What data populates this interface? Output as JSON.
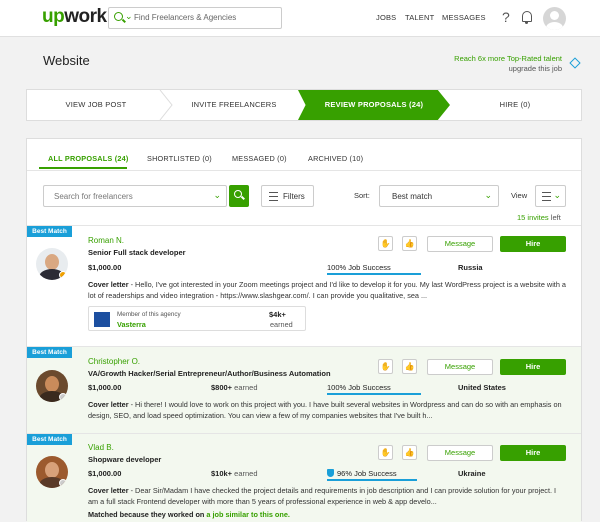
{
  "header": {
    "logo": "upwork",
    "search_placeholder": "Find Freelancers & Agencies",
    "nav": [
      "JOBS",
      "TALENT",
      "MESSAGES"
    ],
    "help": "?"
  },
  "page": {
    "title": "Website",
    "promo_line1": "Reach 6x more Top-Rated talent",
    "promo_line2": "upgrade this job"
  },
  "steps": [
    "VIEW JOB POST",
    "INVITE FREELANCERS",
    "REVIEW PROPOSALS (24)",
    "HIRE (0)"
  ],
  "tabs": [
    "ALL PROPOSALS (24)",
    "SHORTLISTED (0)",
    "MESSAGED (0)",
    "ARCHIVED (10)"
  ],
  "toolbar": {
    "search_placeholder": "Search for freelancers",
    "filters_label": "Filters",
    "sort_label": "Sort:",
    "sort_value": "Best match",
    "view_label": "View",
    "invites_count": "15 invites",
    "invites_suffix": " left"
  },
  "cards": [
    {
      "badge": "Best Match",
      "name": "Roman N.",
      "title": "Senior Full stack developer",
      "rate": "$1,000.00",
      "job_success": "100% Job Success",
      "job_success_pct": 100,
      "country": "Russia",
      "cover_label": "Cover letter",
      "cover_text": " - Hello, I've got interested in your Zoom meetings project and I'd like to develop it for you. My last WordPress project is a website with a lot of readerships and video integration - https://www.slashgear.com/. I can provide you qualitative, sea ...",
      "agency_line1": "Member of this agency",
      "agency_name": "Vasterra",
      "agency_earned": "$4k+",
      "agency_earned_label": "earned",
      "message": "Message",
      "hire": "Hire"
    },
    {
      "badge": "Best Match",
      "name": "Christopher O.",
      "title": "VA/Growth Hacker/Serial Entrepreneur/Author/Business Automation",
      "rate": "$1,000.00",
      "earned": "$800+",
      "earned_label": "earned",
      "job_success": "100% Job Success",
      "job_success_pct": 100,
      "country": "United States",
      "cover_label": "Cover letter",
      "cover_text": " - Hi there! I would love to work on this project with you. I have built several websites in Wordpress and can do so with an emphasis on design, SEO, and load speed optimization. You can view a few of my companies websites that I've built h...",
      "message": "Message",
      "hire": "Hire"
    },
    {
      "badge": "Best Match",
      "name": "Vlad B.",
      "title": "Shopware developer",
      "rate": "$1,000.00",
      "earned": "$10k+",
      "earned_label": "earned",
      "job_success": "96% Job Success",
      "job_success_pct": 96,
      "country": "Ukraine",
      "cover_label": "Cover letter",
      "cover_text": " - Dear Sir/Madam I have checked the project details and requirements in job description and I can provide solution for your project. I am a full stack Frontend developer with more than 5 years of professional experience in web & app develo...",
      "matched_prefix": "Matched because they worked on ",
      "matched_link": "a job similar to this one.",
      "message": "Message",
      "hire": "Hire"
    }
  ]
}
